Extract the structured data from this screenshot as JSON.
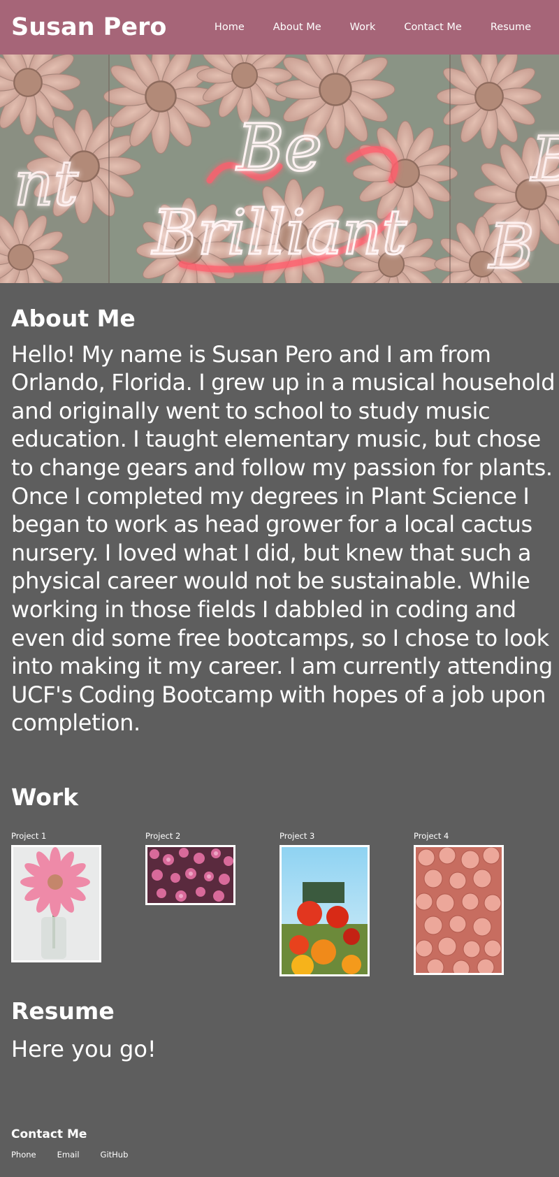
{
  "header": {
    "title": "Susan Pero",
    "nav": [
      "Home",
      "About Me",
      "Work",
      "Contact Me",
      "Resume"
    ]
  },
  "hero": {
    "neon_text_line1": "Be",
    "neon_text_line2": "Brilliant"
  },
  "about": {
    "heading": "About Me",
    "text": "Hello! My name is Susan Pero and I am from Orlando, Florida. I grew up in a musical household and originally went to school to study music education. I taught elementary music, but chose to change gears and follow my passion for plants. Once I completed my degrees in Plant Science I began to work as head grower for a local cactus nursery. I loved what I did, but knew that such a physical career would not be sustainable. While working in those fields I dabbled in coding and even did some free bootcamps, so I chose to look into making it my career. I am currently attending UCF's Coding Bootcamp with hopes of a job upon completion."
  },
  "work": {
    "heading": "Work",
    "projects": [
      {
        "label": "Project 1"
      },
      {
        "label": "Project 2"
      },
      {
        "label": "Project 3"
      },
      {
        "label": "Project 4"
      }
    ]
  },
  "resume": {
    "heading": "Resume",
    "text": "Here you go!"
  },
  "footer": {
    "heading": "Contact Me",
    "links": [
      "Phone",
      "Email",
      "GitHub"
    ]
  },
  "colors": {
    "header_bg": "#a66578",
    "page_bg": "#5e5e5e",
    "text": "#ffffff"
  }
}
